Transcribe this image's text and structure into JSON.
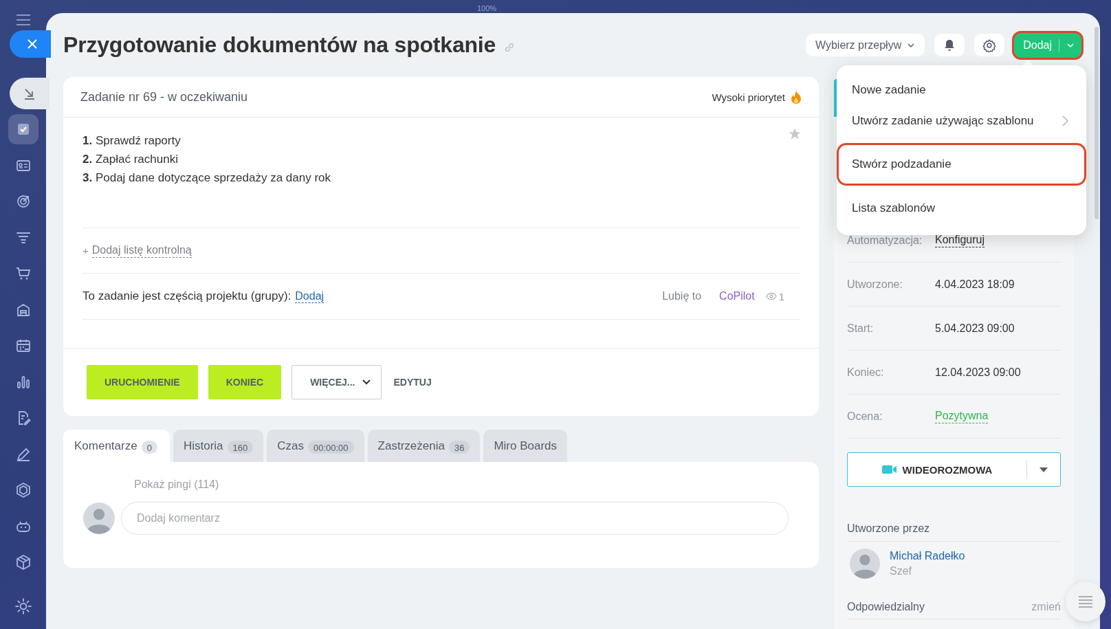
{
  "zoom_label": "100%",
  "sidebar_items": [
    {
      "selected": true
    },
    {
      "selected": false
    },
    {
      "selected": false
    },
    {
      "selected": false
    },
    {
      "selected": false
    },
    {
      "selected": false
    },
    {
      "selected": false
    },
    {
      "selected": false
    },
    {
      "selected": false
    },
    {
      "selected": false
    },
    {
      "selected": false
    },
    {
      "selected": false
    },
    {
      "selected": false
    }
  ],
  "title": "Przygotowanie dokumentów na spotkanie",
  "header": {
    "flow_select": "Wybierz przepływ",
    "add_button": {
      "label": "Dodaj",
      "highlighted": true
    }
  },
  "task": {
    "status": "Zadanie nr 69 - w oczekiwaniu",
    "priority": "Wysoki priorytet",
    "description": [
      {
        "number": "1.",
        "text": "Sprawdź raporty"
      },
      {
        "number": "2.",
        "text": "Zapłać rachunki"
      },
      {
        "number": "3.",
        "text": "Podaj dane dotyczące sprzedaży za dany rok"
      }
    ],
    "add_checklist": {
      "plus": "+",
      "link": "Dodaj listę kontrolną"
    },
    "project": {
      "text": "To zadanie jest częścią projektu (grupy):",
      "link": "Dodaj"
    },
    "like": "Lubię to",
    "copilot": "CoPilot",
    "views": "1",
    "actions": [
      {
        "label": "URUCHOMIENIE",
        "kind": "primary"
      },
      {
        "label": "KONIEC",
        "kind": "primary"
      },
      {
        "label": "WIĘCEJ...",
        "kind": "dropdown"
      },
      {
        "label": "EDYTUJ",
        "kind": "link"
      }
    ]
  },
  "tabs": [
    {
      "label": "Komentarze",
      "count": "0",
      "selected": true
    },
    {
      "label": "Historia",
      "count": "160",
      "selected": false
    },
    {
      "label": "Czas",
      "count": "00:00:00",
      "selected": false
    },
    {
      "label": "Zastrzeżenia",
      "count": "36",
      "selected": false
    },
    {
      "label": "Miro Boards",
      "selected": false
    }
  ],
  "comments": {
    "show_pings": "Pokaż pingi (114)",
    "placeholder": "Dodaj komentarz"
  },
  "menu": [
    {
      "label": "Nowe zadanie",
      "submenu": false,
      "highlighted": false
    },
    {
      "label": "Utwórz zadanie używając szablonu",
      "submenu": true,
      "highlighted": false
    },
    {
      "label": "Stwórz podzadanie",
      "submenu": false,
      "highlighted": true
    },
    {
      "label": "Lista szablonów",
      "submenu": false,
      "highlighted": false
    }
  ],
  "details": [
    {
      "label": "Automatyzacja:",
      "value": "Konfiguruj",
      "kind": "link"
    },
    {
      "label": "Utworzone:",
      "value": "4.04.2023 18:09",
      "kind": "text"
    },
    {
      "label": "Start:",
      "value": "5.04.2023 09:00",
      "kind": "text"
    },
    {
      "label": "Koniec:",
      "value": "12.04.2023 09:00",
      "kind": "text"
    },
    {
      "label": "Ocena:",
      "value": "Pozytywna",
      "kind": "positive"
    }
  ],
  "video_button": "WIDEOROZMOWA",
  "created_by": {
    "heading": "Utworzone przez",
    "name": "Michał Radełko",
    "role": "Szef"
  },
  "responsible": {
    "heading": "Odpowiedzialny",
    "action": "zmień"
  }
}
